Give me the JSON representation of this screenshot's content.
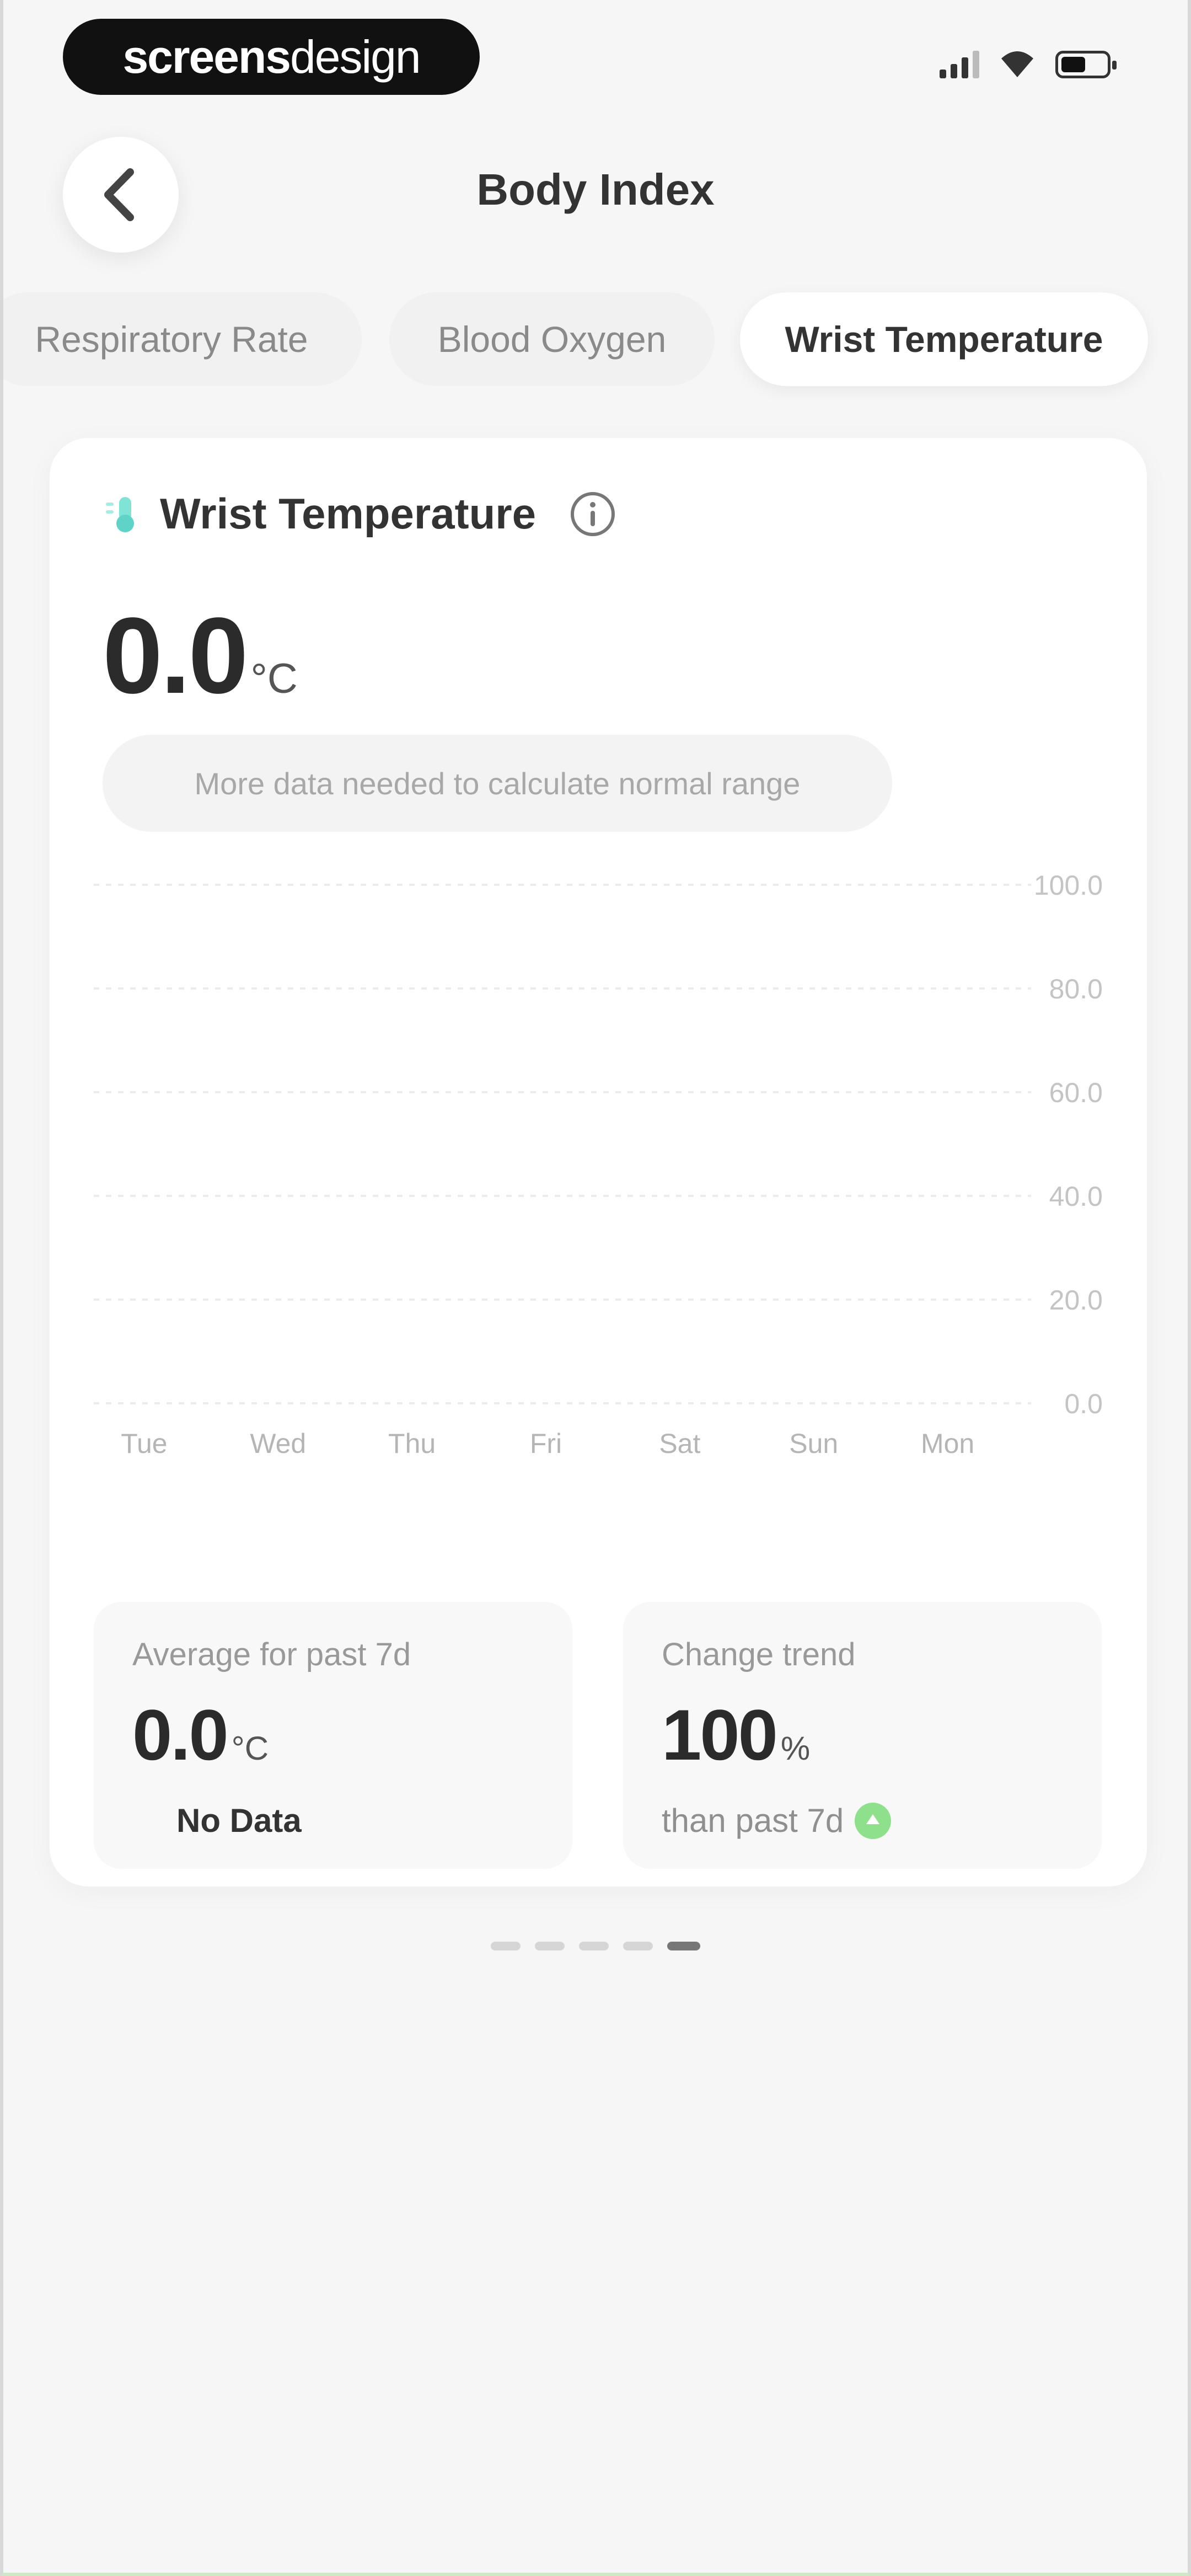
{
  "status_bar": {
    "brand_part1": "screens",
    "brand_part2": "design",
    "icons": [
      "signal-icon",
      "wifi-icon",
      "battery-icon"
    ],
    "battery_level": 0.55
  },
  "header": {
    "title": "Body Index",
    "back_icon": "chevron-left-icon"
  },
  "tabs": [
    {
      "label": "Respiratory Rate",
      "active": false
    },
    {
      "label": "Blood Oxygen",
      "active": false
    },
    {
      "label": "Wrist Temperature",
      "active": true
    }
  ],
  "card": {
    "title": "Wrist Temperature",
    "icon": "thermometer-icon",
    "info_icon": "info-icon",
    "value": "0.0",
    "unit": "°C",
    "range_note": "More data needed to calculate normal range"
  },
  "chart_data": {
    "type": "bar",
    "categories": [
      "Tue",
      "Wed",
      "Thu",
      "Fri",
      "Sat",
      "Sun",
      "Mon"
    ],
    "values": [
      0,
      0,
      0,
      0,
      0,
      0,
      0
    ],
    "yticks": [
      "100.0",
      "80.0",
      "60.0",
      "40.0",
      "20.0",
      "0.0"
    ],
    "ylim": [
      0,
      100
    ],
    "grid": true
  },
  "stats": {
    "average": {
      "label": "Average for past 7d",
      "value": "0.0",
      "unit": "°C",
      "sub": "No Data"
    },
    "trend": {
      "label": "Change trend",
      "value": "100",
      "unit": "%",
      "sub": "than past 7d",
      "indicator_icon": "trend-up-icon"
    }
  },
  "pager": {
    "count": 5,
    "active_index": 4
  },
  "colors": {
    "accent_teal": "#5fd3c8",
    "trend_green": "#8ee08c",
    "background": "#f6f6f6"
  }
}
